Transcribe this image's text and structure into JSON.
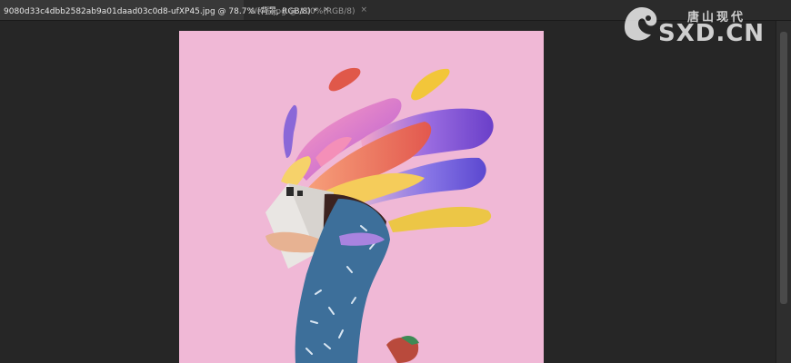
{
  "tabs": [
    {
      "label": "9080d33c4dbb2582ab9a01daad03c0d8-ufXP45.jpg @ 78.7% (背景, RGB/8) *",
      "close": "×",
      "active": true
    },
    {
      "label": "WX号.jpg @ 100%(RGB/8)",
      "close": "×",
      "active": false
    }
  ],
  "watermark": {
    "chinese": "唐山现代",
    "latin": "SXD.CN"
  },
  "canvas": {
    "background": "#f0b8d6"
  }
}
